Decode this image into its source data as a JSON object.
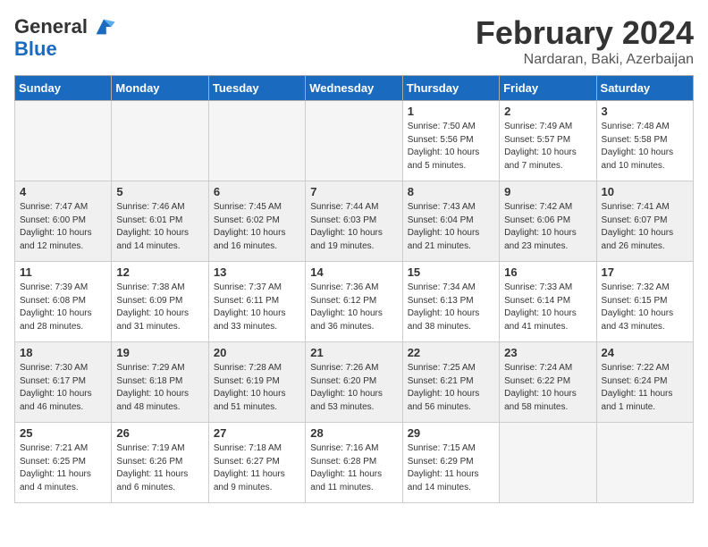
{
  "logo": {
    "general": "General",
    "blue": "Blue"
  },
  "header": {
    "month": "February 2024",
    "location": "Nardaran, Baki, Azerbaijan"
  },
  "weekdays": [
    "Sunday",
    "Monday",
    "Tuesday",
    "Wednesday",
    "Thursday",
    "Friday",
    "Saturday"
  ],
  "weeks": [
    [
      {
        "day": "",
        "info": ""
      },
      {
        "day": "",
        "info": ""
      },
      {
        "day": "",
        "info": ""
      },
      {
        "day": "",
        "info": ""
      },
      {
        "day": "1",
        "info": "Sunrise: 7:50 AM\nSunset: 5:56 PM\nDaylight: 10 hours\nand 5 minutes."
      },
      {
        "day": "2",
        "info": "Sunrise: 7:49 AM\nSunset: 5:57 PM\nDaylight: 10 hours\nand 7 minutes."
      },
      {
        "day": "3",
        "info": "Sunrise: 7:48 AM\nSunset: 5:58 PM\nDaylight: 10 hours\nand 10 minutes."
      }
    ],
    [
      {
        "day": "4",
        "info": "Sunrise: 7:47 AM\nSunset: 6:00 PM\nDaylight: 10 hours\nand 12 minutes."
      },
      {
        "day": "5",
        "info": "Sunrise: 7:46 AM\nSunset: 6:01 PM\nDaylight: 10 hours\nand 14 minutes."
      },
      {
        "day": "6",
        "info": "Sunrise: 7:45 AM\nSunset: 6:02 PM\nDaylight: 10 hours\nand 16 minutes."
      },
      {
        "day": "7",
        "info": "Sunrise: 7:44 AM\nSunset: 6:03 PM\nDaylight: 10 hours\nand 19 minutes."
      },
      {
        "day": "8",
        "info": "Sunrise: 7:43 AM\nSunset: 6:04 PM\nDaylight: 10 hours\nand 21 minutes."
      },
      {
        "day": "9",
        "info": "Sunrise: 7:42 AM\nSunset: 6:06 PM\nDaylight: 10 hours\nand 23 minutes."
      },
      {
        "day": "10",
        "info": "Sunrise: 7:41 AM\nSunset: 6:07 PM\nDaylight: 10 hours\nand 26 minutes."
      }
    ],
    [
      {
        "day": "11",
        "info": "Sunrise: 7:39 AM\nSunset: 6:08 PM\nDaylight: 10 hours\nand 28 minutes."
      },
      {
        "day": "12",
        "info": "Sunrise: 7:38 AM\nSunset: 6:09 PM\nDaylight: 10 hours\nand 31 minutes."
      },
      {
        "day": "13",
        "info": "Sunrise: 7:37 AM\nSunset: 6:11 PM\nDaylight: 10 hours\nand 33 minutes."
      },
      {
        "day": "14",
        "info": "Sunrise: 7:36 AM\nSunset: 6:12 PM\nDaylight: 10 hours\nand 36 minutes."
      },
      {
        "day": "15",
        "info": "Sunrise: 7:34 AM\nSunset: 6:13 PM\nDaylight: 10 hours\nand 38 minutes."
      },
      {
        "day": "16",
        "info": "Sunrise: 7:33 AM\nSunset: 6:14 PM\nDaylight: 10 hours\nand 41 minutes."
      },
      {
        "day": "17",
        "info": "Sunrise: 7:32 AM\nSunset: 6:15 PM\nDaylight: 10 hours\nand 43 minutes."
      }
    ],
    [
      {
        "day": "18",
        "info": "Sunrise: 7:30 AM\nSunset: 6:17 PM\nDaylight: 10 hours\nand 46 minutes."
      },
      {
        "day": "19",
        "info": "Sunrise: 7:29 AM\nSunset: 6:18 PM\nDaylight: 10 hours\nand 48 minutes."
      },
      {
        "day": "20",
        "info": "Sunrise: 7:28 AM\nSunset: 6:19 PM\nDaylight: 10 hours\nand 51 minutes."
      },
      {
        "day": "21",
        "info": "Sunrise: 7:26 AM\nSunset: 6:20 PM\nDaylight: 10 hours\nand 53 minutes."
      },
      {
        "day": "22",
        "info": "Sunrise: 7:25 AM\nSunset: 6:21 PM\nDaylight: 10 hours\nand 56 minutes."
      },
      {
        "day": "23",
        "info": "Sunrise: 7:24 AM\nSunset: 6:22 PM\nDaylight: 10 hours\nand 58 minutes."
      },
      {
        "day": "24",
        "info": "Sunrise: 7:22 AM\nSunset: 6:24 PM\nDaylight: 11 hours\nand 1 minute."
      }
    ],
    [
      {
        "day": "25",
        "info": "Sunrise: 7:21 AM\nSunset: 6:25 PM\nDaylight: 11 hours\nand 4 minutes."
      },
      {
        "day": "26",
        "info": "Sunrise: 7:19 AM\nSunset: 6:26 PM\nDaylight: 11 hours\nand 6 minutes."
      },
      {
        "day": "27",
        "info": "Sunrise: 7:18 AM\nSunset: 6:27 PM\nDaylight: 11 hours\nand 9 minutes."
      },
      {
        "day": "28",
        "info": "Sunrise: 7:16 AM\nSunset: 6:28 PM\nDaylight: 11 hours\nand 11 minutes."
      },
      {
        "day": "29",
        "info": "Sunrise: 7:15 AM\nSunset: 6:29 PM\nDaylight: 11 hours\nand 14 minutes."
      },
      {
        "day": "",
        "info": ""
      },
      {
        "day": "",
        "info": ""
      }
    ]
  ]
}
